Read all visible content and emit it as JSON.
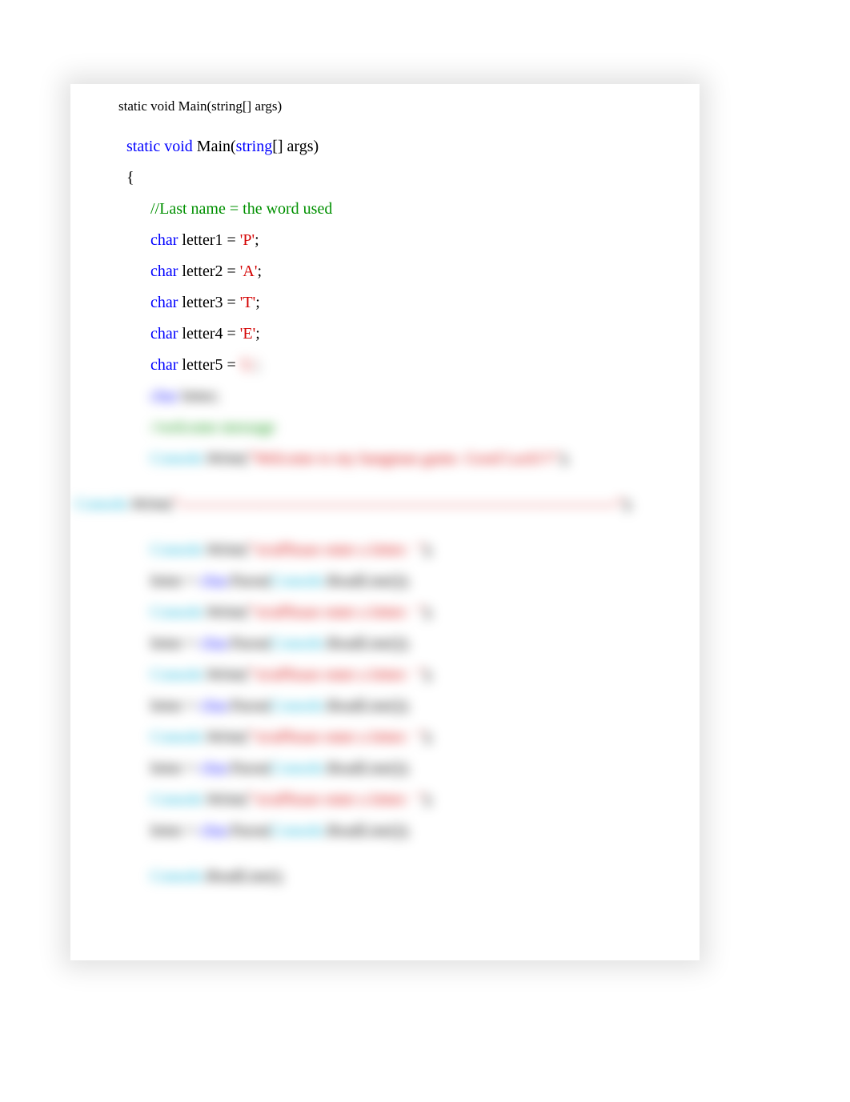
{
  "header": "static void Main(string[] args)",
  "code": {
    "sig_kw1": "static",
    "sig_kw2": "void",
    "sig_name": " Main(",
    "sig_kw3": "string",
    "sig_rest": "[] args)",
    "brace_open": "{",
    "comment1": "//Last name = the word used",
    "char_kw": "char",
    "l1_decl": " letter1 = ",
    "l1_val": "'P'",
    "l2_decl": " letter2 = ",
    "l2_val": "'A'",
    "l3_decl": " letter3 = ",
    "l3_val": "'T'",
    "l4_decl": " letter4 = ",
    "l4_val": "'E'",
    "l5_decl": " letter5 = ",
    "l5_val": "'L'",
    "semicolon": ";",
    "letter_decl": " letter;",
    "comment2": "//welcome message",
    "console": "Console",
    "write": ".Write(",
    "welcome_str": "\"Welcome to my hangman game. Good Luck!!!\"",
    "close_paren_semi": ");",
    "dash_str": "\"----------------------------------------------------------------------------------\"",
    "enter_str": "\"\\n\\nPlease enter a letter:  \"",
    "letter_assign_pre": "letter = ",
    "parse": ".Parse(",
    "readline": ".ReadLine());",
    "readline_plain": ".ReadLine();"
  }
}
